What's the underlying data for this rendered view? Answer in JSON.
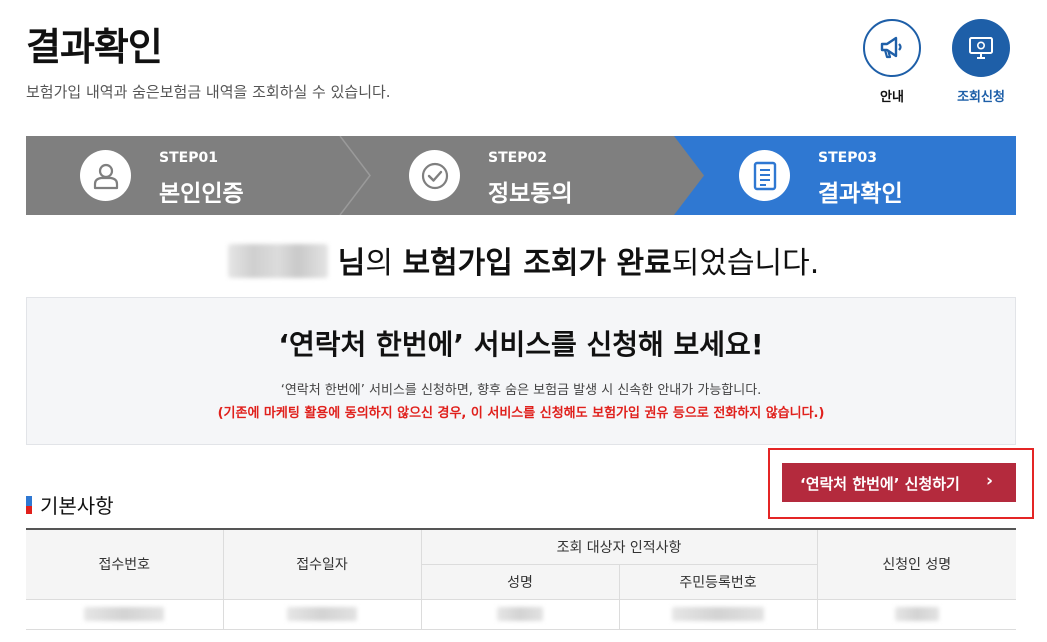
{
  "header": {
    "title": "결과확인",
    "description": "보험가입 내역과 숨은보험금 내역을 조회하실 수 있습니다."
  },
  "top_buttons": {
    "guide": {
      "label": "안내",
      "icon": "megaphone-icon"
    },
    "apply": {
      "label": "조회신청",
      "icon": "monitor-icon"
    }
  },
  "steps": [
    {
      "num": "STEP01",
      "name": "본인인증",
      "icon": "person-icon",
      "active": false
    },
    {
      "num": "STEP02",
      "name": "정보동의",
      "icon": "check-circle-icon",
      "active": false
    },
    {
      "num": "STEP03",
      "name": "결과확인",
      "icon": "document-icon",
      "active": true
    }
  ],
  "complete_message": {
    "suffix_1": "님",
    "suffix_2": "의 ",
    "bold_1": "보험가입 조회가 완료",
    "tail": "되었습니다."
  },
  "promo": {
    "title": "‘연락처 한번에’ 서비스를 신청해 보세요!",
    "description": "‘연락처 한번에’ 서비스를 신청하면, 향후 숨은 보험금 발생 시 신속한 안내가 가능합니다.",
    "warning": "(기존에 마케팅 활용에 동의하지 않으신 경우, 이 서비스를 신청해도 보험가입 권유 등으로 전화하지 않습니다.)"
  },
  "cta": {
    "label": "‘연락처 한번에’ 신청하기",
    "chevron": "›"
  },
  "section": {
    "title": "기본사항"
  },
  "table": {
    "headers": {
      "receipt_no": "접수번호",
      "receipt_date": "접수일자",
      "target_group": "조회 대상자 인적사항",
      "name": "성명",
      "resident_no": "주민등록번호",
      "applicant_name": "신청인 성명"
    }
  },
  "colors": {
    "accent_blue": "#2f78d2",
    "step_gray": "#7f7f7f",
    "cta_red": "#b42a3d",
    "warning_red": "#e0201c"
  }
}
